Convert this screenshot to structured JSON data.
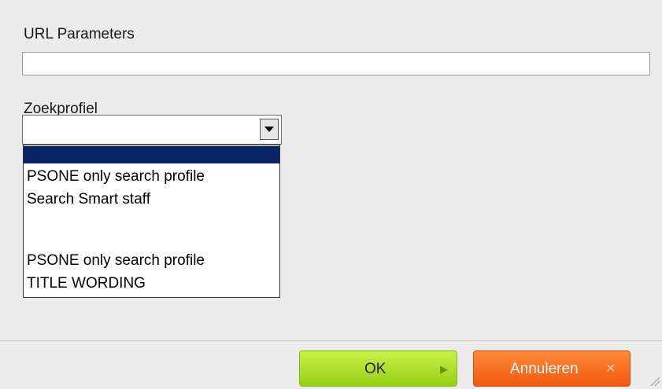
{
  "form": {
    "url_label": "URL Parameters",
    "url_value": "",
    "profile_label": "Zoekprofiel",
    "profile_selected": "",
    "profile_options": [
      "",
      "PSONE only search profile",
      "Search Smart staff",
      "",
      "PSONE only search profile",
      "TITLE WORDING"
    ]
  },
  "buttons": {
    "ok_label": "OK",
    "cancel_label": "Annuleren"
  },
  "icons": {
    "select_arrow": "triangle-down-icon",
    "ok_icon": "play-icon",
    "cancel_icon": "close-icon",
    "resize_grip": "resize-grip-icon"
  },
  "colors": {
    "ok_button": "#a6dc1f",
    "cancel_button": "#f56a18",
    "selected_option": "#0a246a"
  }
}
